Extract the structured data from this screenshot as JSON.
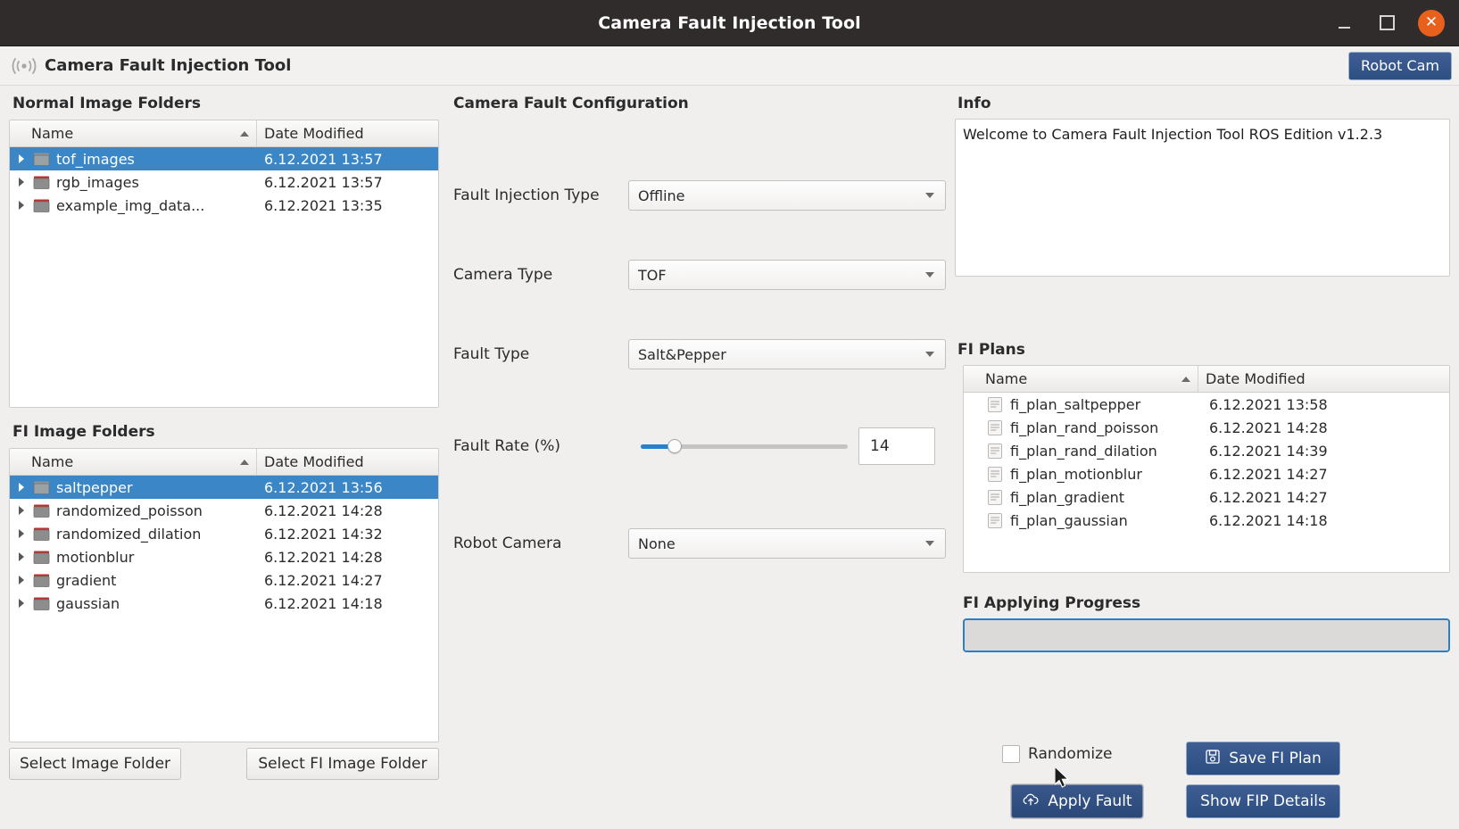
{
  "window": {
    "title": "Camera Fault Injection Tool",
    "controls": {
      "minimize": "minimize-button",
      "maximize": "maximize-button",
      "close": "✕"
    }
  },
  "header": {
    "icon": "broadcast-signal-icon",
    "title": "Camera Fault Injection Tool",
    "robot_cam_label": "Robot Cam"
  },
  "normal_image_folders": {
    "title": "Normal Image Folders",
    "columns": {
      "name": "Name",
      "date": "Date Modified"
    },
    "rows": [
      {
        "name": "tof_images",
        "date": "6.12.2021 13:57",
        "selected": true
      },
      {
        "name": "rgb_images",
        "date": "6.12.2021 13:57",
        "selected": false
      },
      {
        "name": "example_img_data...",
        "date": "6.12.2021 13:35",
        "selected": false
      }
    ]
  },
  "fi_image_folders": {
    "title": "FI Image Folders",
    "columns": {
      "name": "Name",
      "date": "Date Modified"
    },
    "rows": [
      {
        "name": "saltpepper",
        "date": "6.12.2021 13:56",
        "selected": true
      },
      {
        "name": "randomized_poisson",
        "date": "6.12.2021 14:28",
        "selected": false
      },
      {
        "name": "randomized_dilation",
        "date": "6.12.2021 14:32",
        "selected": false
      },
      {
        "name": "motionblur",
        "date": "6.12.2021 14:28",
        "selected": false
      },
      {
        "name": "gradient",
        "date": "6.12.2021 14:27",
        "selected": false
      },
      {
        "name": "gaussian",
        "date": "6.12.2021 14:18",
        "selected": false
      }
    ]
  },
  "bottom_buttons": {
    "select_image_folder": "Select Image Folder",
    "select_fi_image_folder": "Select FI Image Folder"
  },
  "camera_fault_configuration": {
    "title": "Camera Fault Configuration",
    "fields": {
      "fault_injection_type": {
        "label": "Fault Injection Type",
        "value": "Offline"
      },
      "camera_type": {
        "label": "Camera Type",
        "value": "TOF"
      },
      "fault_type": {
        "label": "Fault Type",
        "value": "Salt&Pepper"
      },
      "fault_rate": {
        "label": "Fault Rate (%)",
        "value": "14",
        "percent": 14,
        "min": 0,
        "max": 100
      },
      "robot_camera": {
        "label": "Robot Camera",
        "value": "None"
      }
    }
  },
  "info": {
    "title": "Info",
    "text": "Welcome to Camera Fault Injection Tool ROS Edition v1.2.3"
  },
  "fi_plans": {
    "title": "FI Plans",
    "columns": {
      "name": "Name",
      "date": "Date Modified"
    },
    "rows": [
      {
        "name": "fi_plan_saltpepper",
        "date": "6.12.2021 13:58"
      },
      {
        "name": "fi_plan_rand_poisson",
        "date": "6.12.2021 14:28"
      },
      {
        "name": "fi_plan_rand_dilation",
        "date": "6.12.2021 14:39"
      },
      {
        "name": "fi_plan_motionblur",
        "date": "6.12.2021 14:27"
      },
      {
        "name": "fi_plan_gradient",
        "date": "6.12.2021 14:27"
      },
      {
        "name": "fi_plan_gaussian",
        "date": "6.12.2021 14:18"
      }
    ]
  },
  "progress": {
    "title": "FI Applying Progress",
    "value": 0
  },
  "actions": {
    "randomize_label": "Randomize",
    "randomize_checked": false,
    "save_fi_plan": "Save FI Plan",
    "apply_fault": "Apply Fault",
    "show_fip_details": "Show FIP Details"
  },
  "colors": {
    "titlebar": "#2f2c2b",
    "close_button": "#e8601c",
    "selection": "#3b86c6",
    "accent_blue": "#2a7fc9",
    "button_blue": "#2d4e81",
    "window_bg": "#f0efee"
  }
}
